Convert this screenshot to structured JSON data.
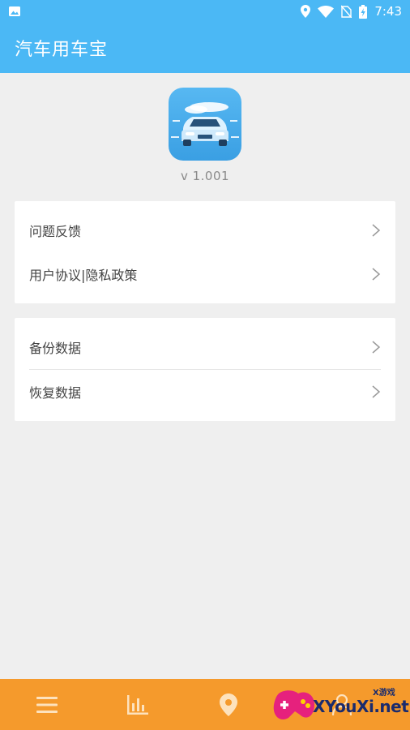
{
  "status": {
    "time": "7:43"
  },
  "app": {
    "title": "汽车用车宝",
    "version": "v 1.001"
  },
  "menu_group_1": [
    {
      "label": "问题反馈"
    },
    {
      "label": "用户协议|隐私政策"
    }
  ],
  "menu_group_2": [
    {
      "label": "备份数据"
    },
    {
      "label": "恢复数据"
    }
  ],
  "bottom_nav": {
    "icons": [
      "menu-icon",
      "bar-chart-icon",
      "location-pin-icon",
      "person-icon"
    ],
    "color": "#f59a2c"
  },
  "watermark": {
    "text": "XYouXi.net",
    "small": "X游戏"
  },
  "colors": {
    "header": "#4bb8f5",
    "background": "#efefef",
    "nav": "#f59a2c"
  }
}
